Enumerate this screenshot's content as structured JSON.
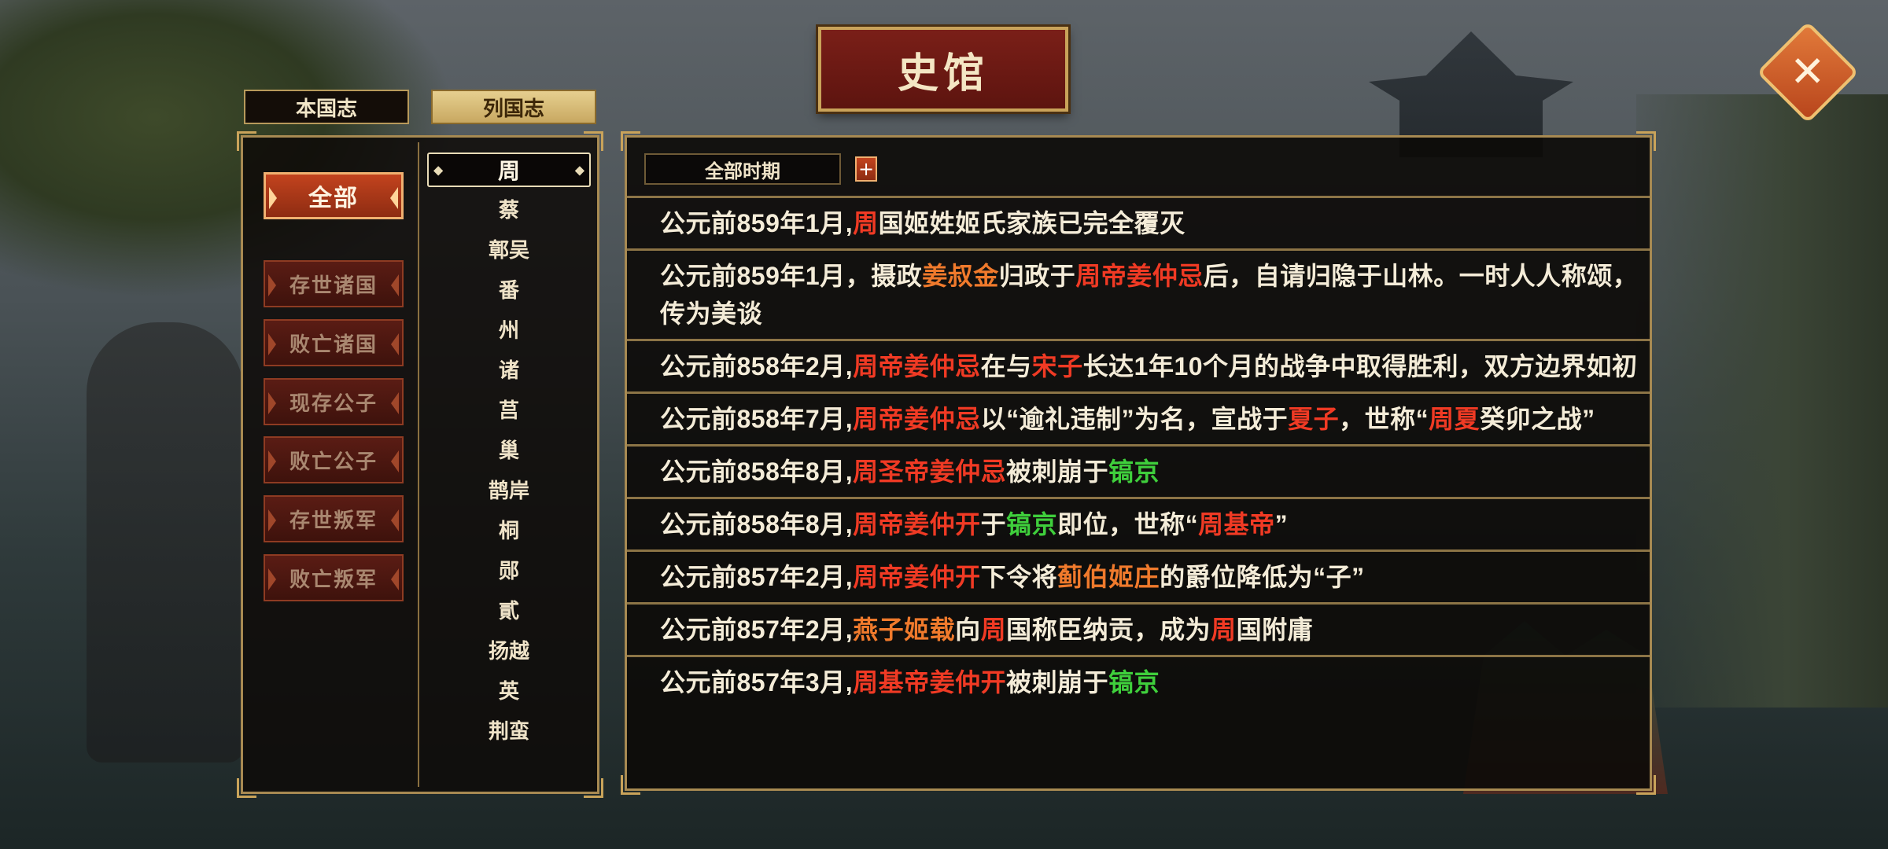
{
  "title": "史馆",
  "close_icon_glyph": "✕",
  "tabs": [
    {
      "label": "本国志",
      "active": false
    },
    {
      "label": "列国志",
      "active": true
    }
  ],
  "filters": [
    {
      "label": "全部",
      "active": true
    },
    {
      "label": "存世诸国",
      "active": false
    },
    {
      "label": "败亡诸国",
      "active": false
    },
    {
      "label": "现存公子",
      "active": false
    },
    {
      "label": "败亡公子",
      "active": false
    },
    {
      "label": "存世叛军",
      "active": false
    },
    {
      "label": "败亡叛军",
      "active": false
    }
  ],
  "states": [
    "周",
    "蔡",
    "鄣吴",
    "番",
    "州",
    "诸",
    "莒",
    "巢",
    "鹊岸",
    "桐",
    "郧",
    "貳",
    "扬越",
    "英",
    "荆蛮"
  ],
  "selected_state": "周",
  "period": {
    "label": "全部时期",
    "add_glyph": "+"
  },
  "colors": {
    "red": "#f03a24",
    "orange": "#f07a2c",
    "green": "#3fcf3c",
    "text": "#f4ecd8",
    "gold": "#c9a35a"
  },
  "records": [
    [
      {
        "t": "公元前859年1月,"
      },
      {
        "t": "周",
        "c": "red"
      },
      {
        "t": "国姬姓姬氏家族已完全覆灭"
      }
    ],
    [
      {
        "t": "公元前859年1月，摄政"
      },
      {
        "t": "姜叔金",
        "c": "orange"
      },
      {
        "t": "归政于"
      },
      {
        "t": "周帝姜仲忌",
        "c": "red"
      },
      {
        "t": "后，自请归隐于山林。一时人人称颂，传为美谈"
      }
    ],
    [
      {
        "t": "公元前858年2月,"
      },
      {
        "t": "周帝姜仲忌",
        "c": "red"
      },
      {
        "t": "在与"
      },
      {
        "t": "宋子",
        "c": "red"
      },
      {
        "t": "长达1年10个月的战争中取得胜利，双方边界如初"
      }
    ],
    [
      {
        "t": "公元前858年7月,"
      },
      {
        "t": "周帝姜仲忌",
        "c": "red"
      },
      {
        "t": "以“逾礼违制”为名，宣战于"
      },
      {
        "t": "夏子",
        "c": "red"
      },
      {
        "t": "，世称“"
      },
      {
        "t": "周夏",
        "c": "red"
      },
      {
        "t": "癸卯之战”"
      }
    ],
    [
      {
        "t": "公元前858年8月,"
      },
      {
        "t": "周圣帝姜仲忌",
        "c": "red"
      },
      {
        "t": "被刺崩于"
      },
      {
        "t": "镐京",
        "c": "green"
      }
    ],
    [
      {
        "t": "公元前858年8月,"
      },
      {
        "t": "周帝姜仲开",
        "c": "red"
      },
      {
        "t": "于"
      },
      {
        "t": "镐京",
        "c": "green"
      },
      {
        "t": "即位，世称“"
      },
      {
        "t": "周基帝",
        "c": "red"
      },
      {
        "t": "”"
      }
    ],
    [
      {
        "t": "公元前857年2月,"
      },
      {
        "t": "周帝姜仲开",
        "c": "red"
      },
      {
        "t": "下令将"
      },
      {
        "t": "蓟伯姬庄",
        "c": "orange"
      },
      {
        "t": "的爵位降低为“子”"
      }
    ],
    [
      {
        "t": "公元前857年2月,"
      },
      {
        "t": "燕子姬载",
        "c": "orange"
      },
      {
        "t": "向"
      },
      {
        "t": "周",
        "c": "red"
      },
      {
        "t": "国称臣纳贡，成为"
      },
      {
        "t": "周",
        "c": "red"
      },
      {
        "t": "国附庸"
      }
    ],
    [
      {
        "t": "公元前857年3月,"
      },
      {
        "t": "周基帝姜仲开",
        "c": "red"
      },
      {
        "t": "被刺崩于"
      },
      {
        "t": "镐京",
        "c": "green"
      }
    ]
  ]
}
